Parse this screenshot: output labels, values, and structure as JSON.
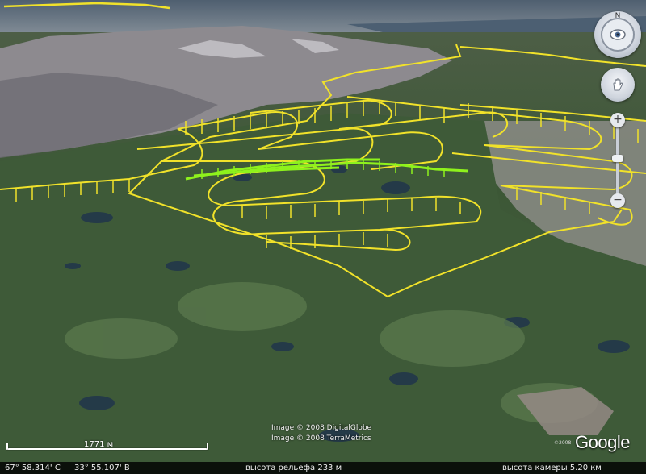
{
  "credits": {
    "line1": "Image © 2008 DigitalGlobe",
    "line2": "Image © 2008 TerraMetrics"
  },
  "logo": {
    "text": "Google",
    "copyright": "©2008"
  },
  "scale": {
    "label": "1771 м"
  },
  "status": {
    "lat": "67° 58.314' С",
    "lon": "33° 55.107' В",
    "elevation": "высота рельефа  233 м",
    "camera": "высота камеры   5.20 км"
  },
  "controls": {
    "north_label": "N"
  },
  "colors": {
    "track": "#f1e22a",
    "track_highlight": "#8ef21c",
    "lake": "#2f4a5e",
    "forest": "#3f5a3a"
  }
}
